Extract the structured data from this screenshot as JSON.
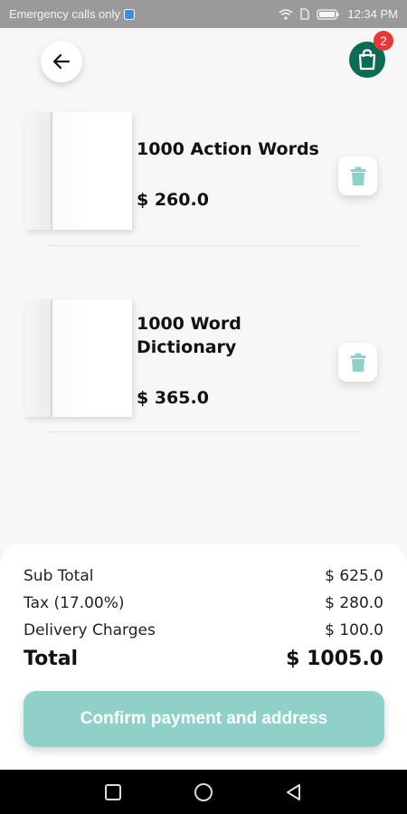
{
  "status_bar": {
    "left_text": "Emergency calls only",
    "time": "12:34 PM"
  },
  "header": {
    "back_icon": "arrow-left-icon",
    "cart_icon": "shopping-bag-icon",
    "cart_badge_count": "2"
  },
  "cart_items": [
    {
      "title": "1000 Action Words",
      "price": "$ 260.0",
      "delete_icon": "trash-icon"
    },
    {
      "title": "1000 Word Dictionary",
      "price": "$ 365.0",
      "delete_icon": "trash-icon"
    }
  ],
  "summary": {
    "subtotal_label": "Sub Total",
    "subtotal_value": "$ 625.0",
    "tax_label": "Tax (17.00%)",
    "tax_value": "$ 280.0",
    "delivery_label": "Delivery Charges",
    "delivery_value": "$ 100.0",
    "total_label": "Total",
    "total_value": "$ 1005.0"
  },
  "confirm_button_label": "Confirm payment and address",
  "colors": {
    "accent": "#8fd0c8",
    "cart_button": "#0c6b54",
    "badge": "#e53935",
    "trash": "#8fd0c8"
  },
  "nav_bar": {
    "recent_icon": "square-icon",
    "home_icon": "circle-icon",
    "back_icon": "triangle-back-icon"
  }
}
